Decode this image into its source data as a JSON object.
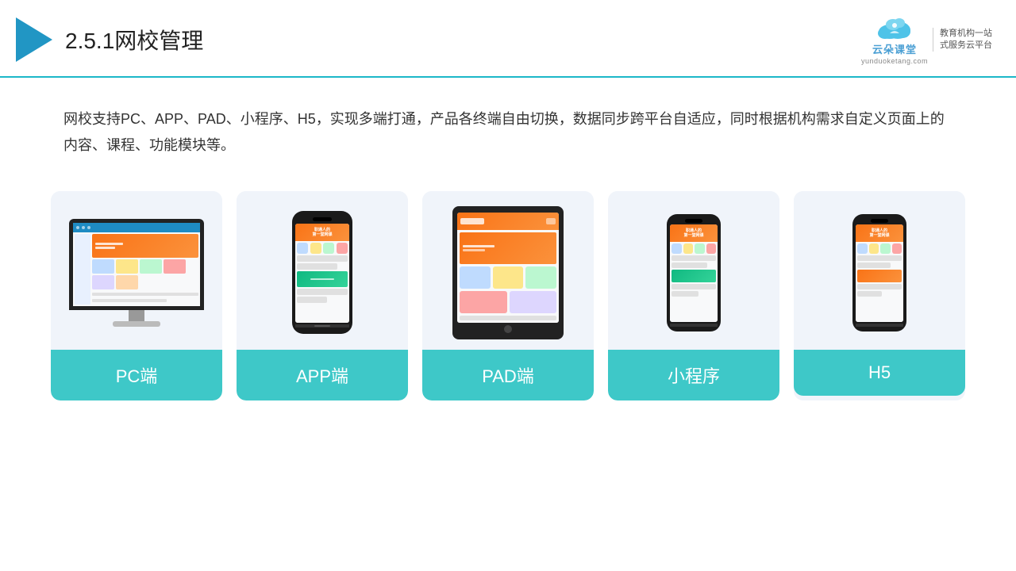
{
  "header": {
    "title_number": "2.5.1",
    "title_text": "网校管理",
    "logo_main": "云朵课堂",
    "logo_sub": "yunduoketang.com",
    "logo_right_line1": "教育机构一站",
    "logo_right_line2": "式服务云平台"
  },
  "description": {
    "text": "网校支持PC、APP、PAD、小程序、H5，实现多端打通，产品各终端自由切换，数据同步跨平台自适应，同时根据机构需求自定义页面上的内容、课程、功能模块等。"
  },
  "cards": [
    {
      "id": "pc",
      "label": "PC端"
    },
    {
      "id": "app",
      "label": "APP端"
    },
    {
      "id": "pad",
      "label": "PAD端"
    },
    {
      "id": "miniprogram",
      "label": "小程序"
    },
    {
      "id": "h5",
      "label": "H5"
    }
  ],
  "colors": {
    "accent": "#3ec8c8",
    "header_border": "#1cb8c8",
    "play_blue": "#2196c4",
    "card_bg": "#f0f4fa",
    "orange": "#f97316"
  }
}
